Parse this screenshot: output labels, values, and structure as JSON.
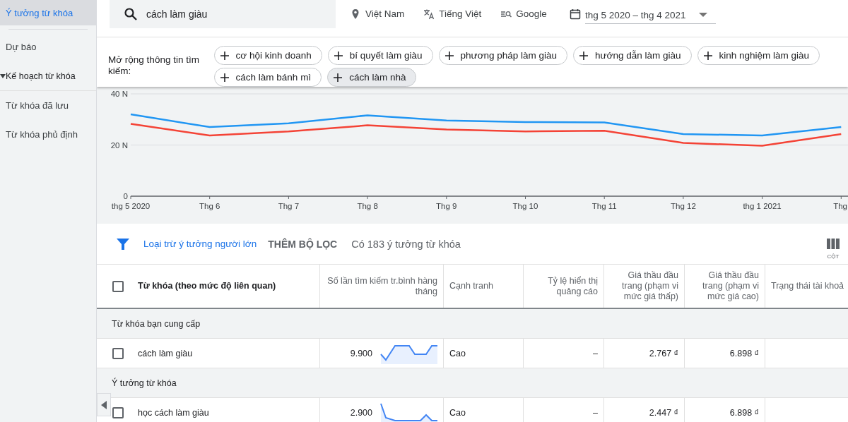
{
  "sidebar": {
    "items": [
      {
        "label": "Ý tưởng từ khóa",
        "selected": true,
        "kind": "link"
      },
      {
        "label": "Dự báo",
        "selected": false,
        "kind": "link"
      },
      {
        "label": "Kế hoạch từ khóa",
        "selected": false,
        "kind": "group"
      },
      {
        "label": "Từ khóa đã lưu",
        "selected": false,
        "kind": "link"
      },
      {
        "label": "Từ khóa phủ định",
        "selected": false,
        "kind": "link"
      }
    ]
  },
  "search_bar": {
    "query": "cách làm giàu",
    "location": "Việt Nam",
    "language": "Tiếng Việt",
    "network": "Google",
    "date_range": "thg 5 2020 – thg 4 2021"
  },
  "refine": {
    "label": "Mở rộng thông tin tìm kiếm:",
    "chips": [
      {
        "label": "cơ hội kinh doanh",
        "hovered": false
      },
      {
        "label": "bí quyết làm giàu",
        "hovered": false
      },
      {
        "label": "phương pháp làm giàu",
        "hovered": false
      },
      {
        "label": "hướng dẫn làm giàu",
        "hovered": false
      },
      {
        "label": "kinh nghiệm làm giàu",
        "hovered": false
      },
      {
        "label": "cách làm bánh mì",
        "hovered": false
      },
      {
        "label": "cách làm nhà",
        "hovered": true
      }
    ]
  },
  "trend": {
    "chart_data": {
      "type": "line",
      "categories": [
        "thg 5 2020",
        "Thg 6",
        "Thg 7",
        "Thg 8",
        "Thg 9",
        "Thg 10",
        "Thg 11",
        "Thg 12",
        "thg 1 2021",
        "Thg"
      ],
      "ylim": [
        0,
        40
      ],
      "yticks": [
        {
          "value": 0,
          "label": "0"
        },
        {
          "value": 20,
          "label": "20 N"
        },
        {
          "value": 40,
          "label": "40 N"
        }
      ],
      "series": [
        {
          "color": "#2196f3",
          "values": [
            32,
            27,
            28.5,
            31.6,
            29.6,
            29,
            28.8,
            24.3,
            23.7,
            27
          ]
        },
        {
          "color": "#f44336",
          "values": [
            28.3,
            23.7,
            25.3,
            27.7,
            26.1,
            25.3,
            25.6,
            20.8,
            19.7,
            24.3
          ]
        }
      ]
    }
  },
  "filter_bar": {
    "exclude_link": "Loại trừ ý tưởng người lớn",
    "add_filter": "THÊM BỘ LỌC",
    "count": "Có 183 ý tưởng từ khóa",
    "columns_button": "CỘT"
  },
  "table": {
    "select_all_checked": false,
    "columns": [
      {
        "label": "Từ khóa (theo mức độ liên quan)"
      },
      {
        "label": "Số lần tìm kiếm tr.bình hàng tháng"
      },
      {
        "label": "Cạnh tranh"
      },
      {
        "label": "Tỷ lệ hiển thị quảng cáo"
      },
      {
        "label": "Giá thầu đầu trang (phạm vi mức giá thấp)"
      },
      {
        "label": "Giá thầu đầu trang (phạm vi mức giá cao)"
      },
      {
        "label": "Trạng thái tài khoả"
      }
    ],
    "groups": [
      {
        "title": "Từ khóa bạn cung cấp",
        "rows": [
          {
            "checked": false,
            "keyword": "cách làm giàu",
            "volume": "9.900",
            "competition": "Cao",
            "impression_share": "–",
            "bid_low": "2.767 ₫",
            "bid_high": "6.898 ₫"
          }
        ]
      },
      {
        "title": "Ý tưởng từ khóa",
        "rows": [
          {
            "checked": false,
            "keyword": "học cách làm giàu",
            "volume": "2.900",
            "competition": "Cao",
            "impression_share": "–",
            "bid_low": "2.447 ₫",
            "bid_high": "6.898 ₫"
          }
        ]
      }
    ]
  }
}
